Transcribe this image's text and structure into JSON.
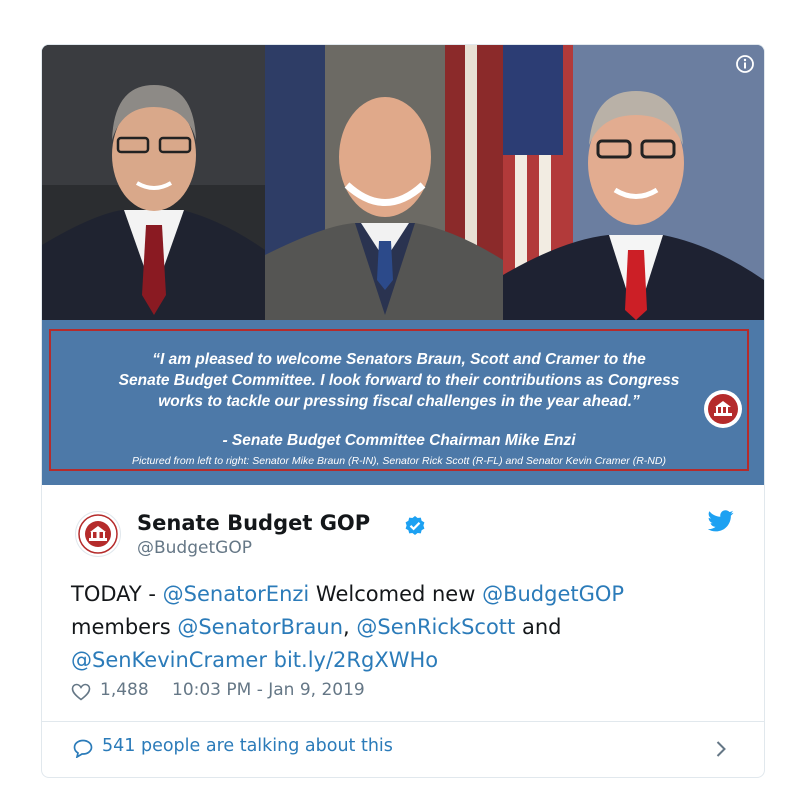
{
  "media": {
    "quote_lines": [
      "“I am pleased to welcome Senators Braun, Scott and Cramer to the",
      "Senate Budget Committee. I look forward to their contributions as Congress",
      "works to tackle our pressing fiscal challenges in the year ahead.”"
    ],
    "attribution": "- Senate Budget Committee Chairman Mike Enzi",
    "caption": "Pictured from left to right: Senator Mike Braun (R-IN), Senator Rick Scott (R-FL) and Senator Kevin Cramer (R-ND)",
    "info_icon": "info-icon"
  },
  "tweet": {
    "display_name": "Senate Budget GOP",
    "handle": "@BudgetGOP",
    "text": {
      "part1": "TODAY - ",
      "mention1": "@SenatorEnzi",
      "part2": " Welcomed new ",
      "mention2": "@BudgetGOP",
      "part3": "members ",
      "mention3": "@SenatorBraun",
      "part4": ", ",
      "mention4": "@SenRickScott",
      "part5": " and",
      "mention5": "@SenKevinCramer",
      "part6": " ",
      "link": "bit.ly/2RgXWHo"
    },
    "likes": "1,488",
    "timestamp": "10:03 PM - Jan 9, 2019",
    "talking": "541 people are talking about this"
  },
  "colors": {
    "link": "#2b7bb9",
    "verified": "#1da1f2",
    "twitter_bird": "#1da1f2",
    "panel": "#4d79a8",
    "panel_border": "#b52b2b"
  },
  "icons": [
    "info-icon",
    "verified-badge-icon",
    "twitter-bird-icon",
    "heart-icon",
    "speech-bubble-icon",
    "chevron-right-icon",
    "senate-seal-logo"
  ]
}
